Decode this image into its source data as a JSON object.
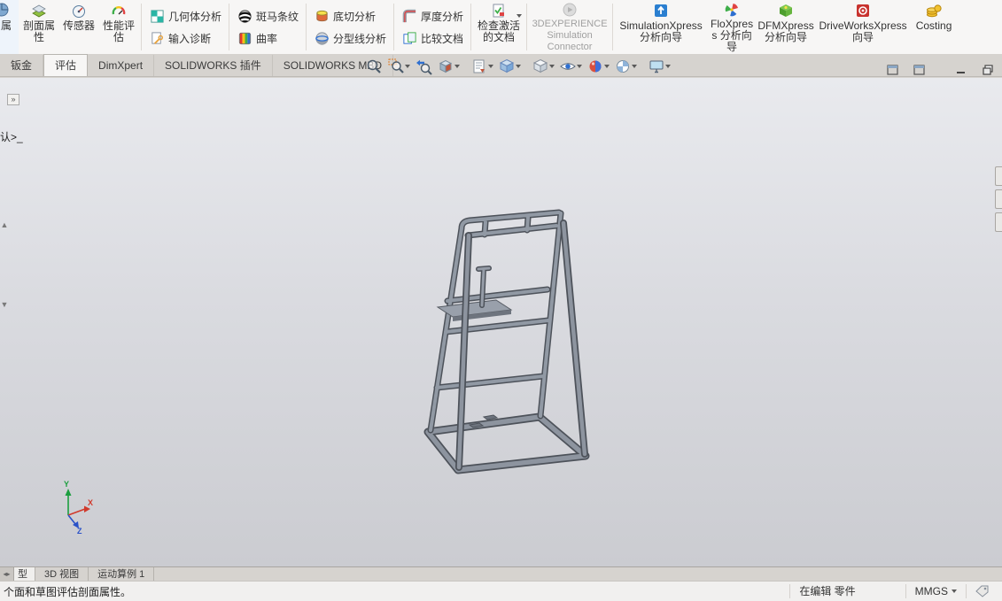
{
  "ribbon": {
    "partial_label": "属",
    "section_properties": "剖面属性",
    "sensors": "传感器",
    "performance": "性能评估",
    "geometry_analysis": "几何体分析",
    "import_diagnostics": "输入诊断",
    "zebra_stripes": "斑马条纹",
    "curvature": "曲率",
    "undercut_analysis": "底切分析",
    "parting_line_analysis": "分型线分析",
    "thickness_analysis": "厚度分析",
    "compare_documents": "比较文档",
    "check_active_document": "检查激活的文档",
    "experience_connector": "3DEXPERIENCE Simulation Connector",
    "simulationxpress": "SimulationXpress 分析向导",
    "floxpress": "FloXpress 分析向导",
    "dfmxpress": "DFMXpress 分析向导",
    "driveworksxpress": "DriveWorksXpress 向导",
    "costing": "Costing"
  },
  "command_tabs": [
    {
      "label": "钣金",
      "active": false
    },
    {
      "label": "评估",
      "active": true
    },
    {
      "label": "DimXpert",
      "active": false
    },
    {
      "label": "SOLIDWORKS 插件",
      "active": false
    },
    {
      "label": "SOLIDWORKS MBD",
      "active": false
    }
  ],
  "feature_tree": {
    "fragment": "认>_",
    "flyout": "»"
  },
  "bottom_tabs": [
    {
      "label": "型",
      "active": true
    },
    {
      "label": "3D 视图",
      "active": false
    },
    {
      "label": "运动算例 1",
      "active": false
    }
  ],
  "status_bar": {
    "message": "个面和草图评估剖面属性。",
    "editing": "在编辑 零件",
    "units": "MMGS"
  },
  "colors": {
    "model_body": "#9199a4",
    "model_edge": "#4d525a",
    "viewport_top": "#e9eaee",
    "viewport_bottom": "#cbccd1",
    "triad_x": "#d03a2c",
    "triad_y": "#1c9e3f",
    "triad_z": "#2a52c8"
  }
}
